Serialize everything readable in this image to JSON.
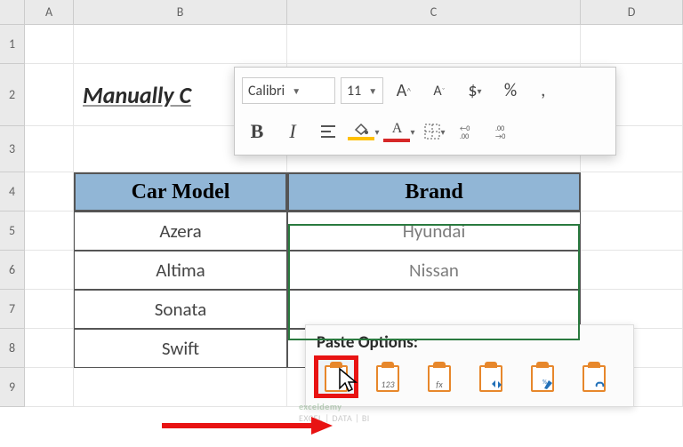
{
  "columns": [
    "A",
    "B",
    "C",
    "D"
  ],
  "rows": [
    "1",
    "2",
    "3",
    "4",
    "5",
    "6",
    "7",
    "8",
    "9"
  ],
  "title": "Manually C",
  "table": {
    "headers": [
      "Car Model",
      "Brand"
    ],
    "data": [
      {
        "model": "Azera",
        "brand": "Hyundai"
      },
      {
        "model": "Altima",
        "brand": "Nissan"
      },
      {
        "model": "Sonata",
        "brand": ""
      },
      {
        "model": "Swift",
        "brand": ""
      }
    ]
  },
  "mini_toolbar": {
    "font_name": "Calibri",
    "font_size": "11",
    "buttons": {
      "increase_font": "A",
      "decrease_font": "A",
      "accounting": "$",
      "percent": "%",
      "bold": "B",
      "italic": "I"
    }
  },
  "paste_options": {
    "title": "Paste Options:",
    "items": [
      {
        "name": "paste",
        "label": ""
      },
      {
        "name": "paste-values",
        "label": "123"
      },
      {
        "name": "paste-formulas",
        "label": "fx"
      },
      {
        "name": "paste-transpose",
        "label": ""
      },
      {
        "name": "paste-formatting",
        "label": ""
      },
      {
        "name": "paste-link",
        "label": ""
      }
    ]
  },
  "watermark": "EXCEL | DATA | BI"
}
